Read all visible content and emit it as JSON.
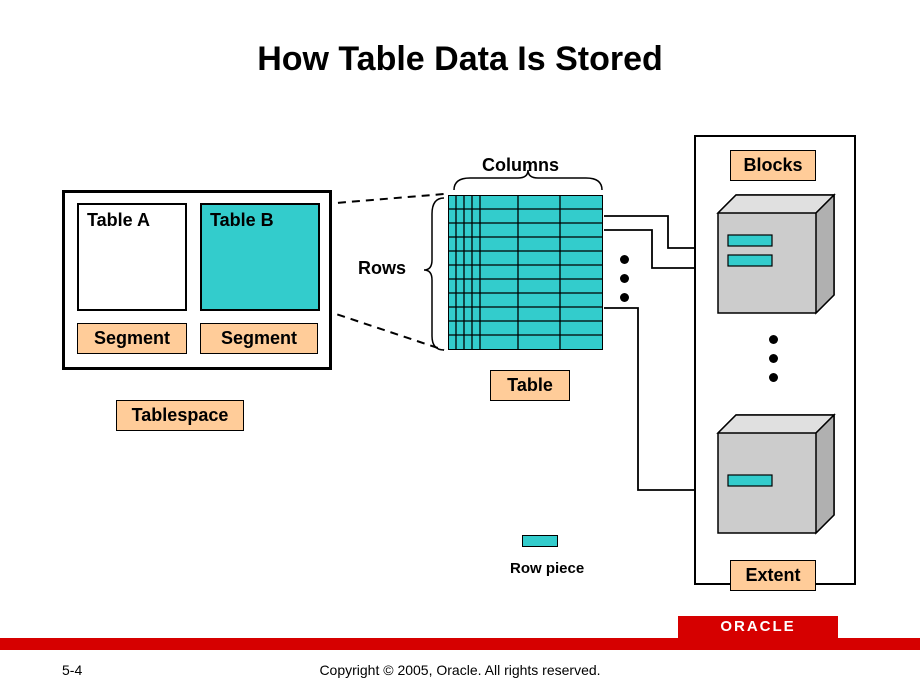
{
  "title": "How Table Data Is Stored",
  "tablespace": {
    "tableA": "Table A",
    "tableB": "Table B",
    "segment1": "Segment",
    "segment2": "Segment",
    "label": "Tablespace"
  },
  "table": {
    "columns_label": "Columns",
    "rows_label": "Rows",
    "label": "Table"
  },
  "rowpiece": {
    "label": "Row piece"
  },
  "storage": {
    "blocks_label": "Blocks",
    "extent_label": "Extent"
  },
  "footer": {
    "page": "5-4",
    "copyright": "Copyright © 2005, Oracle.  All rights reserved.",
    "brand": "ORACLE"
  }
}
